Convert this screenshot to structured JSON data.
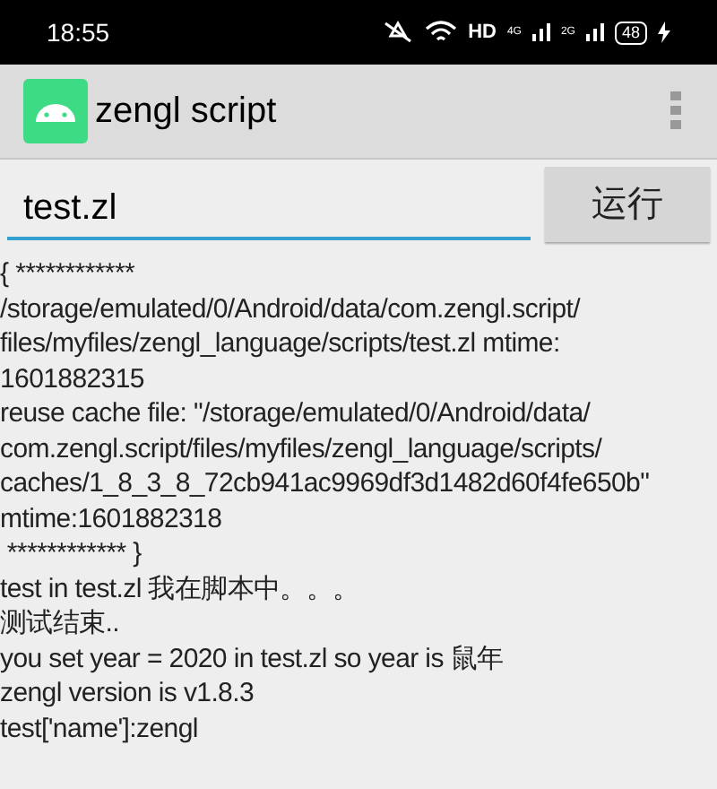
{
  "status_bar": {
    "time": "18:55",
    "network": "HD",
    "sim_1": "4G",
    "sim_2": "2G",
    "battery": "48"
  },
  "app_bar": {
    "title": "zengl script"
  },
  "script_field": {
    "value": "test.zl"
  },
  "run_button": {
    "label": "运行"
  },
  "output_lines": [
    "{ ************",
    "/storage/emulated/0/Android/data/com.zengl.script/",
    "files/myfiles/zengl_language/scripts/test.zl mtime:",
    "1601882315",
    "reuse cache file: \"/storage/emulated/0/Android/data/",
    "com.zengl.script/files/myfiles/zengl_language/scripts/",
    "caches/1_8_3_8_72cb941ac9969df3d1482d60f4fe650b\"",
    "mtime:1601882318",
    " ************ }",
    "test in test.zl 我在脚本中。。。",
    "测试结束..",
    "you set year = 2020 in test.zl so year is 鼠年",
    "zengl version is v1.8.3",
    "test['name']:zengl"
  ]
}
